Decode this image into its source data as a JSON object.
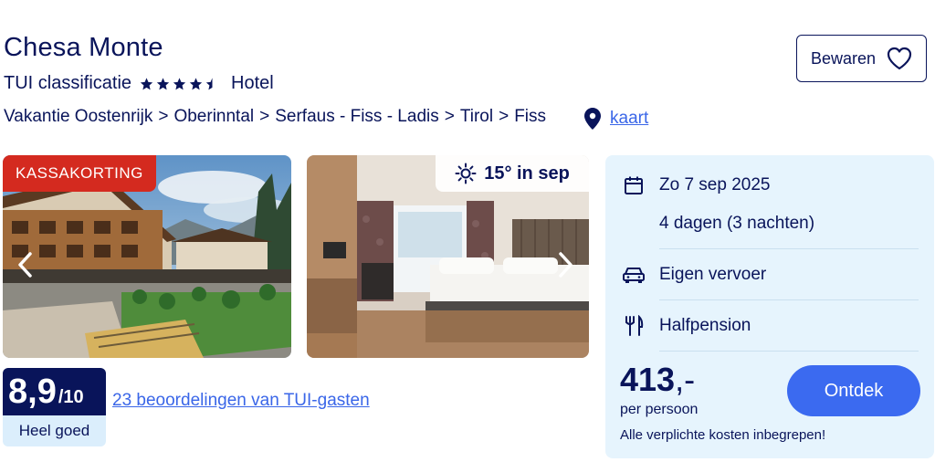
{
  "hotel": {
    "name": "Chesa Monte",
    "classification_label": "TUI classificatie",
    "rating_stars": 4.5,
    "type": "Hotel"
  },
  "breadcrumb": {
    "items": [
      "Vakantie Oostenrijk",
      "Oberinntal",
      "Serfaus - Fiss - Ladis",
      "Tirol",
      "Fiss"
    ],
    "separator": ">"
  },
  "map": {
    "link_label": "kaart",
    "icon": "map-pin-icon"
  },
  "save": {
    "label": "Bewaren",
    "icon": "heart-icon"
  },
  "gallery": {
    "badge": "KASSAKORTING",
    "weather": {
      "icon": "sun-icon",
      "label": "15° in sep"
    },
    "prev_icon": "chevron-left-icon",
    "next_icon": "chevron-right-icon"
  },
  "rating": {
    "score": "8,9",
    "scale": "/10",
    "label": "Heel goed",
    "reviews_link": "23 beoordelingen van TUI-gasten"
  },
  "booking": {
    "date": "Zo 7 sep 2025",
    "duration": "4 dagen (3 nachten)",
    "transport": "Eigen vervoer",
    "board": "Halfpension",
    "price": "413",
    "price_suffix": ",-",
    "price_note": "per persoon",
    "cta": "Ontdek",
    "costs_note": "Alle verplichte kosten inbegrepen!"
  },
  "colors": {
    "navy": "#09145a",
    "link": "#3a66e8",
    "badge_red": "#d42a1f",
    "panel_bg": "#e6f4fd",
    "cta_blue": "#3b6af0"
  }
}
